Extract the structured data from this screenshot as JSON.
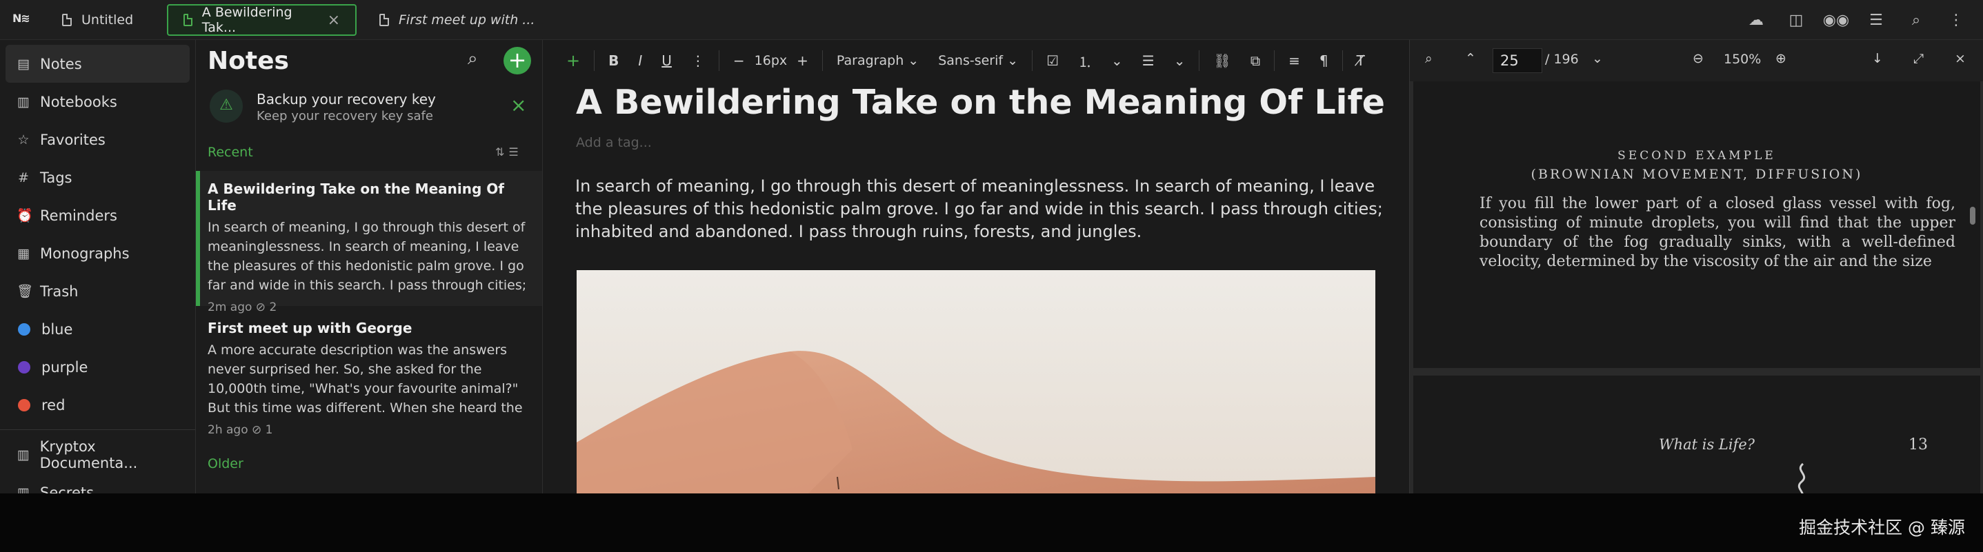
{
  "app": {
    "logo": "N≋"
  },
  "tabs": [
    {
      "label": "Untitled",
      "active": false,
      "italic": false
    },
    {
      "label": "A Bewildering Tak...",
      "active": true,
      "italic": false
    },
    {
      "label": "First meet up with ...",
      "active": false,
      "italic": true
    }
  ],
  "top_icons": [
    "cloud-upload-icon",
    "sidebar-icon",
    "glasses-icon",
    "list-icon",
    "search-icon",
    "more-vertical-icon"
  ],
  "nav": {
    "items": [
      {
        "label": "Notes",
        "icon": "note-icon"
      },
      {
        "label": "Notebooks",
        "icon": "notebook-icon"
      },
      {
        "label": "Favorites",
        "icon": "star-icon"
      },
      {
        "label": "Tags",
        "icon": "hash-icon"
      },
      {
        "label": "Reminders",
        "icon": "alarm-icon"
      },
      {
        "label": "Monographs",
        "icon": "monograph-icon"
      },
      {
        "label": "Trash",
        "icon": "trash-icon"
      }
    ],
    "colors": [
      {
        "label": "blue",
        "color": "#3b8de6"
      },
      {
        "label": "purple",
        "color": "#6a3fc2"
      },
      {
        "label": "red",
        "color": "#e5533c"
      }
    ],
    "shortcuts": [
      {
        "label": "Kryptox Documenta..."
      },
      {
        "label": "Secrets"
      }
    ]
  },
  "notes_list": {
    "title": "Notes",
    "backup": {
      "title": "Backup your recovery key",
      "subtitle": "Keep your recovery key safe"
    },
    "section_recent": "Recent",
    "section_older": "Older",
    "notes": [
      {
        "title": "A Bewildering Take on the Meaning Of Life",
        "preview": "In search of meaning, I go through this desert of meaninglessness. In search of meaning, I leave the pleasures of this hedonistic palm grove. I go far and wide in this search. I pass through cities; inhabited ...",
        "meta": "2m ago  ⊘ 2"
      },
      {
        "title": "First meet up with George",
        "preview": "A more accurate description was the answers never surprised her. So, she asked for the 10,000th time, \"What's your favourite animal?\" But this time was different. When she heard the young boy's answer,...",
        "meta": "2h ago  ⊘ 1"
      }
    ]
  },
  "toolbar": {
    "font_size": "16px",
    "block_type": "Paragraph",
    "font_family": "Sans-serif"
  },
  "editor": {
    "title": "A Bewildering Take on the Meaning Of Life",
    "tag_placeholder": "Add a tag...",
    "paragraph": "In search of meaning, I go through this desert of meaninglessness. In search of meaning, I leave the pleasures of this hedonistic palm grove. I go far and wide in this search. I pass through cities; inhabited and abandoned. I pass through ruins, forests, and jungles."
  },
  "pdf": {
    "page": "25",
    "total": "/ 196",
    "zoom": "150%",
    "page1": {
      "heading": "SECOND EXAMPLE",
      "subheading": "(BROWNIAN MOVEMENT, DIFFUSION)",
      "body": "If you fill the lower part of a closed glass vessel with fog, consisting of minute droplets, you will find that the upper boundary of the fog gradually sinks, with a well-defined velocity, determined by the viscosity of the air and the size"
    },
    "page2": {
      "running_head": "What is Life?",
      "number": "13"
    }
  },
  "footer": {
    "watermark": "掘金技术社区 @ 臻源"
  }
}
